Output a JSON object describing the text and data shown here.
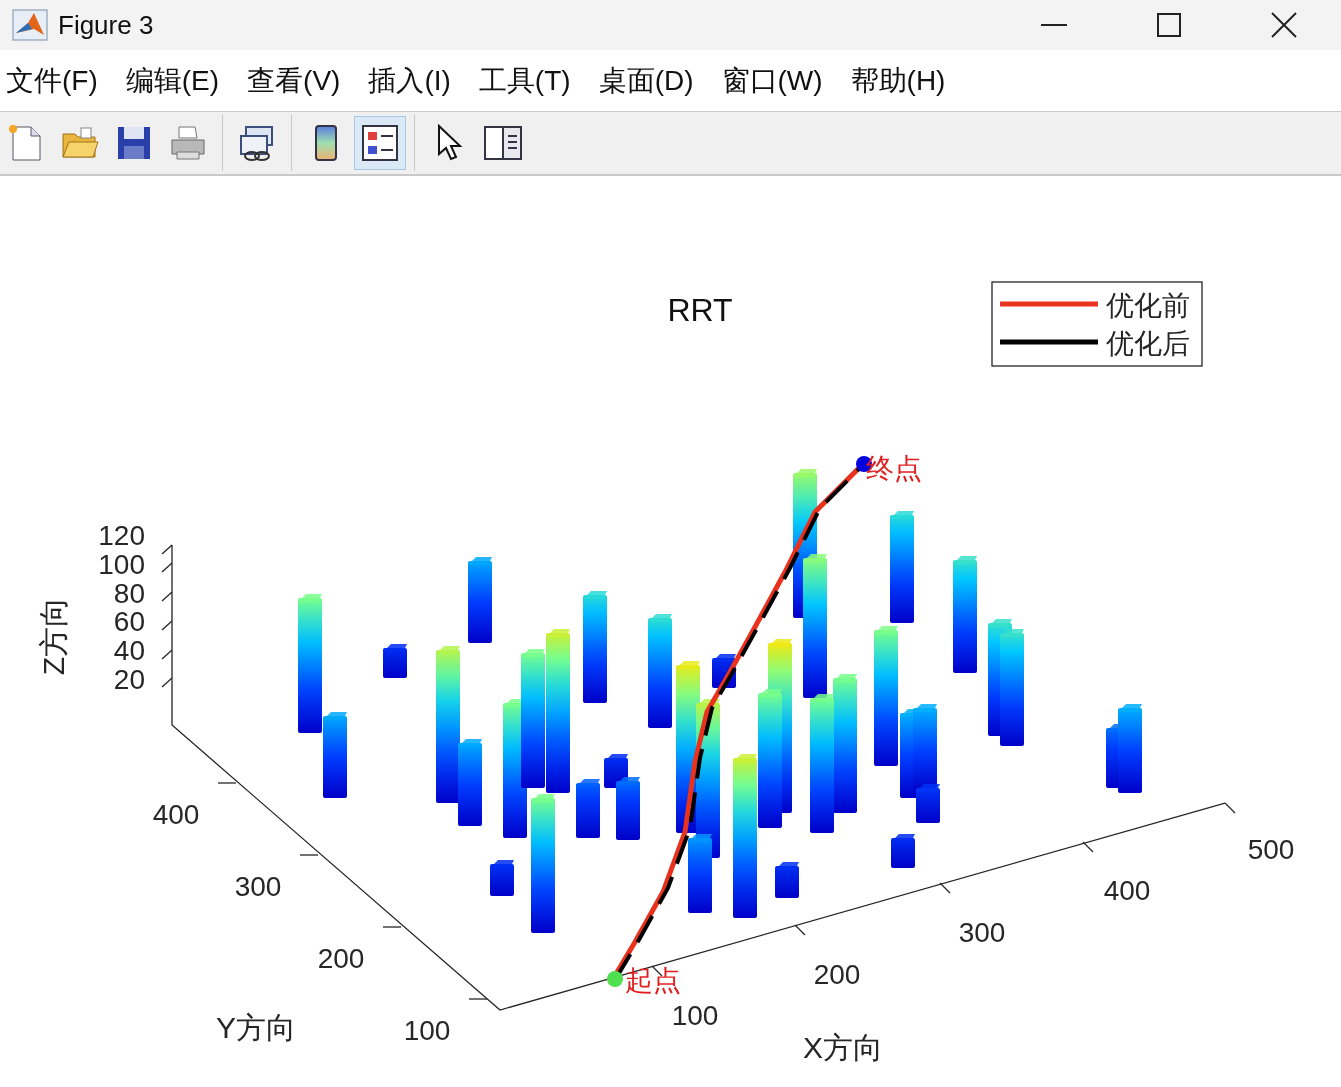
{
  "window": {
    "title": "Figure 3"
  },
  "menu": [
    {
      "label": "文件(F)"
    },
    {
      "label": "编辑(E)"
    },
    {
      "label": "查看(V)"
    },
    {
      "label": "插入(I)"
    },
    {
      "label": "工具(T)"
    },
    {
      "label": "桌面(D)"
    },
    {
      "label": "窗口(W)"
    },
    {
      "label": "帮助(H)"
    }
  ],
  "toolbar": {
    "buttons": [
      {
        "kind": "new",
        "pressed": false
      },
      {
        "kind": "open",
        "pressed": false
      },
      {
        "kind": "save",
        "pressed": false
      },
      {
        "kind": "print",
        "pressed": false
      },
      {
        "kind": "link",
        "pressed": false
      },
      {
        "kind": "colorbar",
        "pressed": false
      },
      {
        "kind": "legend",
        "pressed": true
      },
      {
        "kind": "pointer",
        "pressed": false
      },
      {
        "kind": "panel",
        "pressed": false
      }
    ]
  },
  "plot": {
    "title": "RRT",
    "xlabel": "X方向",
    "ylabel": "Y方向",
    "zlabel": "Z方向",
    "xticks": [
      "100",
      "200",
      "300",
      "400",
      "500"
    ],
    "yticks": [
      "100",
      "200",
      "300",
      "400"
    ],
    "zticks": [
      "120",
      "100",
      "80",
      "60",
      "40",
      "20"
    ],
    "legend": [
      {
        "label": "优化前",
        "color": "#e8321e"
      },
      {
        "label": "优化后",
        "color": "#000000"
      }
    ],
    "start_label": "起点",
    "end_label": "终点"
  }
}
